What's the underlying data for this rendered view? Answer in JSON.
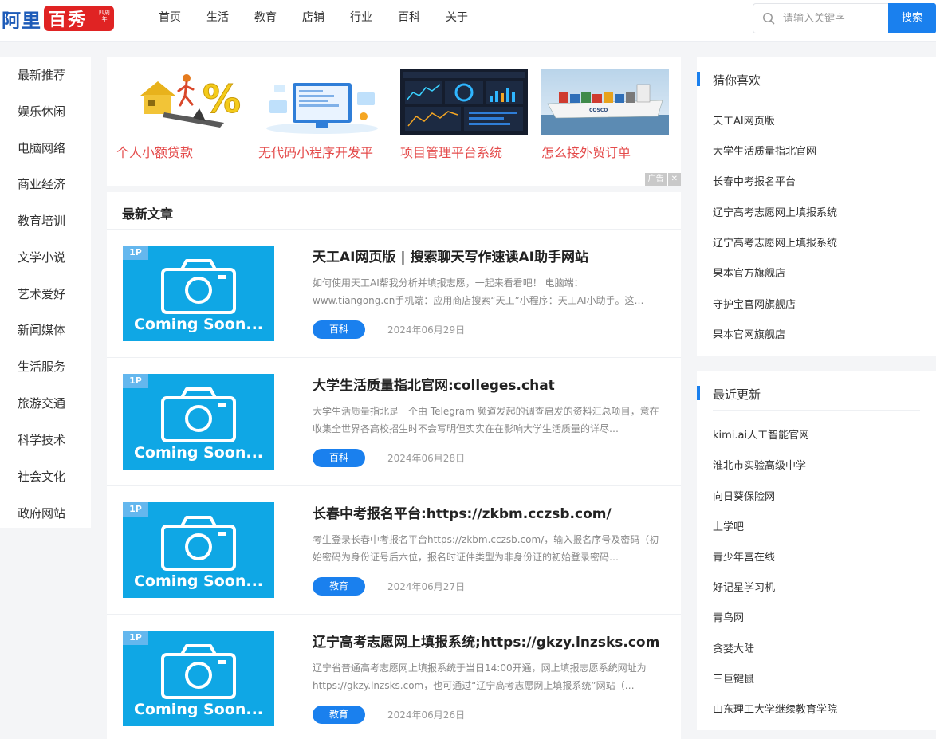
{
  "header": {
    "logo_main": "阿里",
    "logo_box": "百秀",
    "logo_small": "四周年",
    "nav": [
      "首页",
      "生活",
      "教育",
      "店铺",
      "行业",
      "百科",
      "关于"
    ],
    "search_placeholder": "请输入关键字",
    "search_button": "搜索"
  },
  "sidebar": {
    "items": [
      "最新推荐",
      "娱乐休闲",
      "电脑网络",
      "商业经济",
      "教育培训",
      "文学小说",
      "艺术爱好",
      "新闻媒体",
      "生活服务",
      "旅游交通",
      "科学技术",
      "社会文化",
      "政府网站"
    ]
  },
  "ad": {
    "items": [
      "个人小额贷款",
      "无代码小程序开发平",
      "项目管理平台系统",
      "怎么接外贸订单"
    ],
    "badge": "广告",
    "close": "✕",
    "ship_text": "COSCO"
  },
  "articles": {
    "title": "最新文章",
    "thumb_badge": "1P",
    "thumb_text": "Coming Soon...",
    "items": [
      {
        "title": "天工AI网页版 | 搜索聊天写作速读AI助手网站",
        "excerpt": "如何使用天工AI帮我分析并填报志愿，一起来看看吧！ 电脑端：www.tiangong.cn手机端：应用商店搜索“天工”小程序：天工AI小助手。这…",
        "tag": "百科",
        "date": "2024年06月29日"
      },
      {
        "title": "大学生活质量指北官网:colleges.chat",
        "excerpt": "大学生活质量指北是一个由 Telegram 频道发起的调查启发的资料汇总项目，意在收集全世界各高校招生时不会写明但实实在在影响大学生活质量的详尽…",
        "tag": "百科",
        "date": "2024年06月28日"
      },
      {
        "title": "长春中考报名平台:https://zkbm.cczsb.com/",
        "excerpt": "考生登录长春中考报名平台https://zkbm.cczsb.com/，输入报名序号及密码（初始密码为身份证号后六位，报名时证件类型为非身份证的初始登录密码…",
        "tag": "教育",
        "date": "2024年06月27日"
      },
      {
        "title": "辽宁高考志愿网上填报系统;https://gkzy.lnzsks.com",
        "excerpt": "辽宁省普通高考志愿网上填报系统于当日14:00开通，网上填报志愿系统网址为https://gkzy.lnzsks.com，也可通过“辽宁高考志愿网上填报系统”网站（…",
        "tag": "教育",
        "date": "2024年06月26日"
      }
    ]
  },
  "guess": {
    "title": "猜你喜欢",
    "items": [
      "天工AI网页版",
      "大学生活质量指北官网",
      "长春中考报名平台",
      "辽宁高考志愿网上填报系统",
      "辽宁高考志愿网上填报系统",
      "果本官方旗舰店",
      "守护宝官网旗舰店",
      "果本官网旗舰店"
    ]
  },
  "recent": {
    "title": "最近更新",
    "items": [
      "kimi.ai人工智能官网",
      "淮北市实验高级中学",
      "向日葵保险网",
      "上学吧",
      "青少年宫在线",
      "好记星学习机",
      "青鸟网",
      "贪婪大陆",
      "三巨键鼠",
      "山东理工大学继续教育学院"
    ]
  },
  "colors": {
    "accent": "#1a80ee",
    "ad_text": "#e44b4b",
    "thumb_bg": "#0fa7e5",
    "logo_red": "#e02323",
    "logo_blue": "#1d5bb8"
  }
}
